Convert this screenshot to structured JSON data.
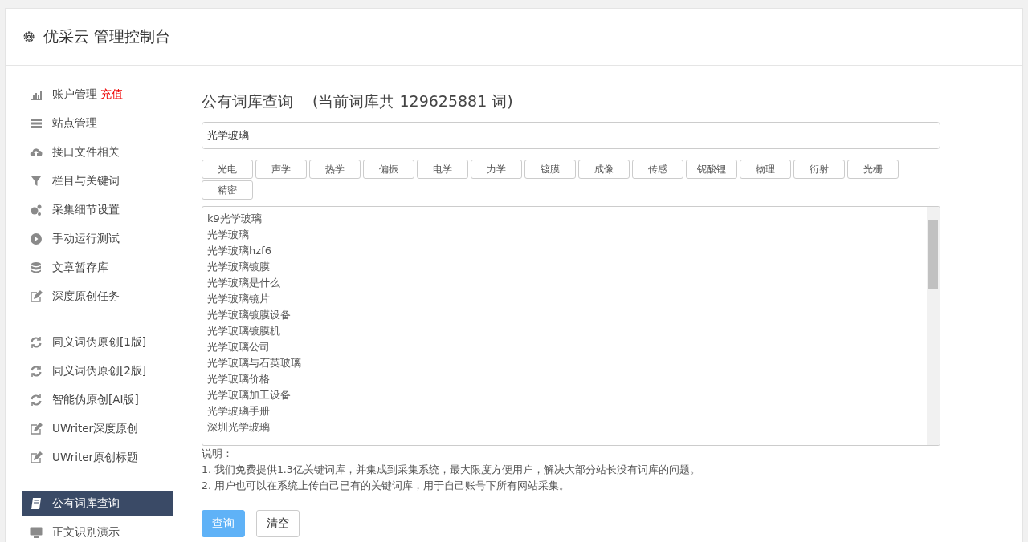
{
  "header": {
    "title": "优采云 管理控制台"
  },
  "sidebar": {
    "groups": [
      {
        "items": [
          {
            "label": "账户管理",
            "badge": "充值",
            "selected": false
          },
          {
            "label": "站点管理",
            "selected": false
          },
          {
            "label": "接口文件相关",
            "selected": false
          },
          {
            "label": "栏目与关键词",
            "selected": false
          },
          {
            "label": "采集细节设置",
            "selected": false
          },
          {
            "label": "手动运行测试",
            "selected": false
          },
          {
            "label": "文章暂存库",
            "selected": false
          },
          {
            "label": "深度原创任务",
            "selected": false
          }
        ]
      },
      {
        "items": [
          {
            "label": "同义词伪原创[1版]",
            "selected": false
          },
          {
            "label": "同义词伪原创[2版]",
            "selected": false
          },
          {
            "label": "智能伪原创[AI版]",
            "selected": false
          },
          {
            "label": "UWriter深度原创",
            "selected": false
          },
          {
            "label": "UWriter原创标题",
            "selected": false
          }
        ]
      },
      {
        "items": [
          {
            "label": "公有词库查询",
            "selected": true
          },
          {
            "label": "正文识别演示",
            "selected": false
          }
        ]
      }
    ]
  },
  "main": {
    "title": "公有词库查询",
    "count_text": "(当前词库共 129625881 词)",
    "search": {
      "value": "光学玻璃"
    },
    "tags": [
      "光电",
      "声学",
      "热学",
      "偏振",
      "电学",
      "力学",
      "镀膜",
      "成像",
      "传感",
      "铌酸锂",
      "物理",
      "衍射",
      "光栅",
      "精密"
    ],
    "results": [
      "k9光学玻璃",
      "光学玻璃",
      "光学玻璃hzf6",
      "光学玻璃镀膜",
      "光学玻璃是什么",
      "光学玻璃镜片",
      "光学玻璃镀膜设备",
      "光学玻璃镀膜机",
      "光学玻璃公司",
      "光学玻璃与石英玻璃",
      "光学玻璃价格",
      "光学玻璃加工设备",
      "光学玻璃手册",
      "深圳光学玻璃"
    ],
    "notes_title": "说明：",
    "notes": [
      "1. 我们免费提供1.3亿关键词库，并集成到采集系统，最大限度方便用户，解决大部分站长没有词库的问题。",
      "2. 用户也可以在系统上传自己已有的关键词库，用于自己账号下所有网站采集。"
    ],
    "buttons": [
      {
        "label": "查询",
        "kind": "primary"
      },
      {
        "label": "清空",
        "kind": "default"
      }
    ]
  }
}
